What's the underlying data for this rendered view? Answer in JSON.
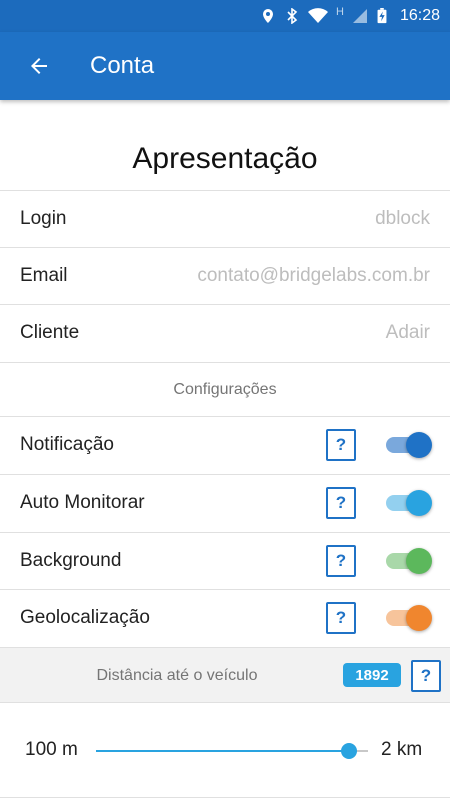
{
  "status_bar": {
    "time": "16:28",
    "network_label": "H"
  },
  "app_bar": {
    "title": "Conta",
    "back_icon": "arrow-left-icon"
  },
  "header": {
    "title": "Apresentação"
  },
  "account_fields": [
    {
      "label": "Login",
      "value": "dblock"
    },
    {
      "label": "Email",
      "value": "contato@bridgelabs.com.br"
    },
    {
      "label": "Cliente",
      "value": "Adair"
    }
  ],
  "settings": {
    "section_title": "Configurações",
    "help_label": "?",
    "toggles": [
      {
        "label": "Notificação",
        "on": true,
        "color": "#1f72c6",
        "track_color": "#7aa8dc"
      },
      {
        "label": "Auto Monitorar",
        "on": true,
        "color": "#29a3e0",
        "track_color": "#93d0ef"
      },
      {
        "label": "Background",
        "on": true,
        "color": "#5cb85c",
        "track_color": "#a9d8a9"
      },
      {
        "label": "Geolocalização",
        "on": true,
        "color": "#f0862e",
        "track_color": "#f7c49b"
      }
    ]
  },
  "distance": {
    "label": "Distância até o veículo",
    "badge_value": "1892",
    "badge_color": "#29a3e0",
    "help_label": "?",
    "slider": {
      "min_label": "100 m",
      "max_label": "2 km",
      "fraction": 0.93,
      "color": "#29a3e0"
    }
  }
}
